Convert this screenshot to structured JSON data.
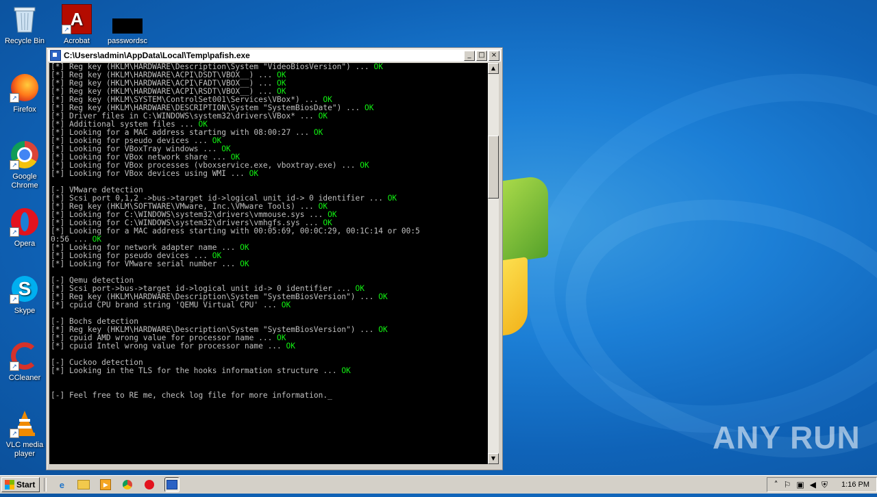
{
  "desktop": {
    "icons": [
      {
        "label": "Recycle Bin"
      },
      {
        "label": "Acrobat"
      },
      {
        "label": "passwordsc"
      },
      {
        "label": "Firefox"
      },
      {
        "label": "Google Chrome"
      },
      {
        "label": "Opera"
      },
      {
        "label": "Skype"
      },
      {
        "label": "CCleaner"
      },
      {
        "label": "VLC media player"
      }
    ],
    "watermark": "ANY RUN"
  },
  "window": {
    "title": "C:\\Users\\admin\\AppData\\Local\\Temp\\pafish.exe",
    "minimize": "_",
    "maximize": "□",
    "close": "×"
  },
  "console": {
    "lines": [
      {
        "text": "[*] Reg key (HKLM\\HARDWARE\\Description\\System \"VideoBiosVersion\") ... ",
        "status": "OK"
      },
      {
        "text": "[*] Reg key (HKLM\\HARDWARE\\ACPI\\DSDT\\VBOX__) ... ",
        "status": "OK"
      },
      {
        "text": "[*] Reg key (HKLM\\HARDWARE\\ACPI\\FADT\\VBOX__) ... ",
        "status": "OK"
      },
      {
        "text": "[*] Reg key (HKLM\\HARDWARE\\ACPI\\RSDT\\VBOX__) ... ",
        "status": "OK"
      },
      {
        "text": "[*] Reg key (HKLM\\SYSTEM\\ControlSet001\\Services\\VBox*) ... ",
        "status": "OK"
      },
      {
        "text": "[*] Reg key (HKLM\\HARDWARE\\DESCRIPTION\\System \"SystemBiosDate\") ... ",
        "status": "OK"
      },
      {
        "text": "[*] Driver files in C:\\WINDOWS\\system32\\drivers\\VBox* ... ",
        "status": "OK"
      },
      {
        "text": "[*] Additional system files ... ",
        "status": "OK"
      },
      {
        "text": "[*] Looking for a MAC address starting with 08:00:27 ... ",
        "status": "OK"
      },
      {
        "text": "[*] Looking for pseudo devices ... ",
        "status": "OK"
      },
      {
        "text": "[*] Looking for VBoxTray windows ... ",
        "status": "OK"
      },
      {
        "text": "[*] Looking for VBox network share ... ",
        "status": "OK"
      },
      {
        "text": "[*] Looking for VBox processes (vboxservice.exe, vboxtray.exe) ... ",
        "status": "OK"
      },
      {
        "text": "[*] Looking for VBox devices using WMI ... ",
        "status": "OK"
      },
      {
        "text": "",
        "status": ""
      },
      {
        "text": "[-] VMware detection",
        "status": ""
      },
      {
        "text": "[*] Scsi port 0,1,2 ->bus->target id->logical unit id-> 0 identifier ... ",
        "status": "OK"
      },
      {
        "text": "[*] Reg key (HKLM\\SOFTWARE\\VMware, Inc.\\VMware Tools) ... ",
        "status": "OK"
      },
      {
        "text": "[*] Looking for C:\\WINDOWS\\system32\\drivers\\vmmouse.sys ... ",
        "status": "OK"
      },
      {
        "text": "[*] Looking for C:\\WINDOWS\\system32\\drivers\\vmhgfs.sys ... ",
        "status": "OK"
      },
      {
        "text": "[*] Looking for a MAC address starting with 00:05:69, 00:0C:29, 00:1C:14 or 00:5",
        "status": ""
      },
      {
        "text": "0:56 ... ",
        "status": "OK"
      },
      {
        "text": "[*] Looking for network adapter name ... ",
        "status": "OK"
      },
      {
        "text": "[*] Looking for pseudo devices ... ",
        "status": "OK"
      },
      {
        "text": "[*] Looking for VMware serial number ... ",
        "status": "OK"
      },
      {
        "text": "",
        "status": ""
      },
      {
        "text": "[-] Qemu detection",
        "status": ""
      },
      {
        "text": "[*] Scsi port->bus->target id->logical unit id-> 0 identifier ... ",
        "status": "OK"
      },
      {
        "text": "[*] Reg key (HKLM\\HARDWARE\\Description\\System \"SystemBiosVersion\") ... ",
        "status": "OK"
      },
      {
        "text": "[*] cpuid CPU brand string 'QEMU Virtual CPU' ... ",
        "status": "OK"
      },
      {
        "text": "",
        "status": ""
      },
      {
        "text": "[-] Bochs detection",
        "status": ""
      },
      {
        "text": "[*] Reg key (HKLM\\HARDWARE\\Description\\System \"SystemBiosVersion\") ... ",
        "status": "OK"
      },
      {
        "text": "[*] cpuid AMD wrong value for processor name ... ",
        "status": "OK"
      },
      {
        "text": "[*] cpuid Intel wrong value for processor name ... ",
        "status": "OK"
      },
      {
        "text": "",
        "status": ""
      },
      {
        "text": "[-] Cuckoo detection",
        "status": ""
      },
      {
        "text": "[*] Looking in the TLS for the hooks information structure ... ",
        "status": "OK"
      },
      {
        "text": "",
        "status": ""
      },
      {
        "text": "",
        "status": ""
      },
      {
        "text": "[-] Feel free to RE me, check log file for more information.",
        "status": "",
        "cursor": "_"
      }
    ]
  },
  "taskbar": {
    "start_label": "Start",
    "clock": "1:16 PM",
    "quick_icons": [
      "ie-icon",
      "explorer-icon",
      "media-player-icon",
      "chrome-icon",
      "opera-icon",
      "pafish-console-icon"
    ]
  },
  "colors": {
    "console_bg": "#000000",
    "console_text": "#c0c0c0",
    "ok_green": "#12f112",
    "desktop_blue": "#1c7fd6"
  }
}
